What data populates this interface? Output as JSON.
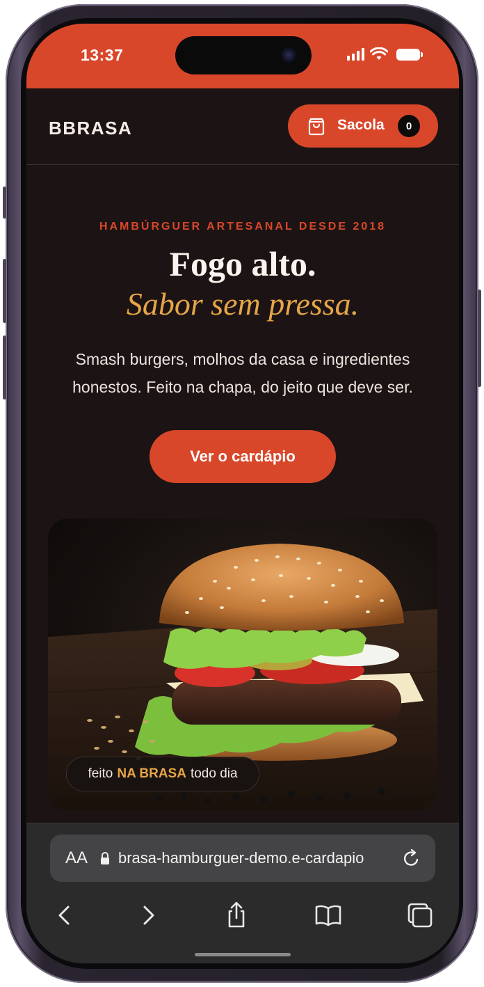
{
  "status_bar": {
    "time": "13:37"
  },
  "header": {
    "logo": "BBRASA",
    "bag_label": "Sacola",
    "bag_count": "0"
  },
  "hero": {
    "eyebrow": "HAMBÚRGUER ARTESANAL DESDE 2018",
    "title": "Fogo alto.",
    "subtitle": "Sabor sem pressa.",
    "description": "Smash burgers, molhos da casa e ingredientes honestos. Feito na chapa, do jeito que deve ser.",
    "cta_label": "Ver o cardápio"
  },
  "photo": {
    "badge_prefix": "feito",
    "badge_highlight": "NA BRASA",
    "badge_suffix": "todo dia"
  },
  "browser": {
    "aa_label": "AA",
    "url": "brasa-hamburguer-demo.e-cardapio"
  },
  "colors": {
    "accent": "#d9472a",
    "gold": "#e6a548",
    "background": "#1c1414"
  },
  "icons": [
    "bag-icon",
    "lock-icon",
    "reload-icon",
    "back-icon",
    "forward-icon",
    "share-icon",
    "bookmarks-icon",
    "tabs-icon",
    "signal-icon",
    "wifi-icon",
    "battery-icon"
  ]
}
